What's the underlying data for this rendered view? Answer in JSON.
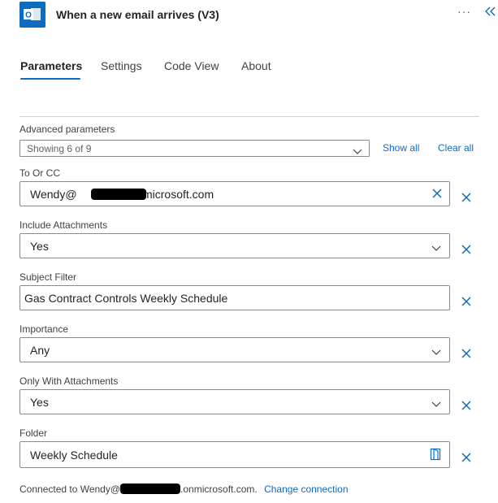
{
  "header": {
    "title": "When a new email arrives (V3)",
    "more_label": "···"
  },
  "tabs": [
    {
      "label": "Parameters"
    },
    {
      "label": "Settings"
    },
    {
      "label": "Code View"
    },
    {
      "label": "About"
    }
  ],
  "advanced": {
    "label": "Advanced parameters",
    "selected": "Showing 6 of 9",
    "show_all": "Show all",
    "clear_all": "Clear all"
  },
  "fields": {
    "to_or_cc": {
      "label": "To Or CC",
      "value_prefix": "Wendy@",
      "value_suffix": ".onmicrosoft.com"
    },
    "include_attachments": {
      "label": "Include Attachments",
      "value": "Yes"
    },
    "subject_filter": {
      "label": "Subject Filter",
      "value": "Gas Contract Controls Weekly Schedule"
    },
    "importance": {
      "label": "Importance",
      "value": "Any"
    },
    "only_with_attachments": {
      "label": "Only With Attachments",
      "value": "Yes"
    },
    "folder": {
      "label": "Folder",
      "value": "Weekly Schedule"
    }
  },
  "footer": {
    "connected_prefix": "Connected to Wendy@",
    "connected_suffix": ".onmicrosoft.com.",
    "change_connection": "Change connection"
  },
  "colors": {
    "accent": "#0f6cbd",
    "border": "#8a8a8a",
    "text": "#242424"
  },
  "icons": [
    "outlook-icon",
    "collapse-panel-icon",
    "chevron-down-icon",
    "clear-icon",
    "remove-parameter-icon",
    "folder-picker-icon"
  ]
}
